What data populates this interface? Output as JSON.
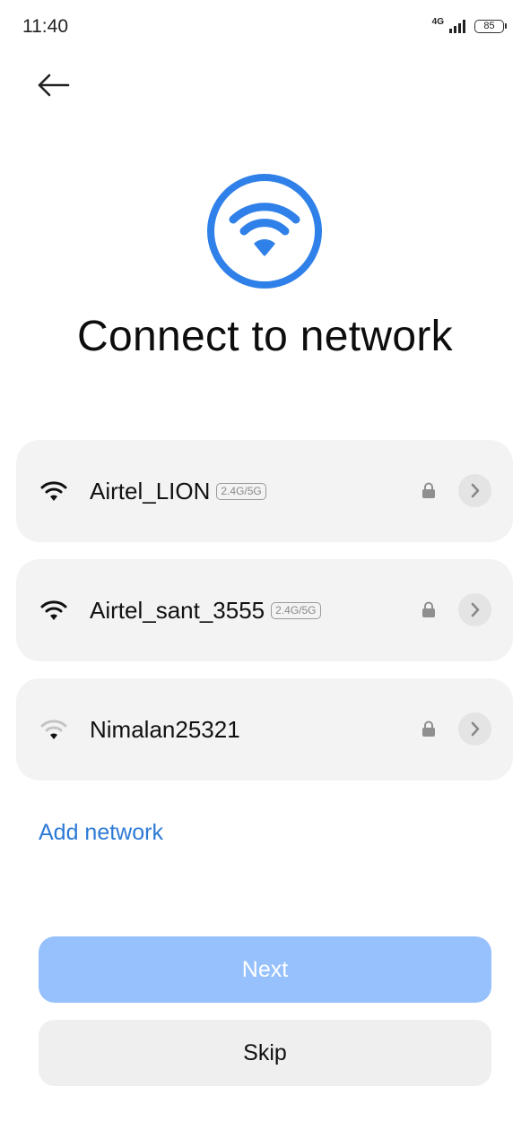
{
  "status_bar": {
    "time": "11:40",
    "network_type": "4G",
    "battery": "85"
  },
  "page": {
    "title": "Connect to network"
  },
  "networks": [
    {
      "name": "Airtel_LION",
      "band": "2.4G/5G",
      "signal": "full"
    },
    {
      "name": "Airtel_sant_3555",
      "band": "2.4G/5G",
      "signal": "full"
    },
    {
      "name": "Nimalan25321",
      "band": "",
      "signal": "weak"
    }
  ],
  "actions": {
    "add_network": "Add network",
    "next": "Next",
    "skip": "Skip"
  },
  "colors": {
    "accent": "#2f80e8",
    "next_button": "#96c1fc",
    "item_background": "#f3f3f3",
    "link": "#2c7ad6"
  },
  "icons": {
    "back": "arrow-left-icon",
    "hero": "wifi-icon",
    "lock": "lock-icon",
    "chevron": "chevron-right-icon"
  }
}
